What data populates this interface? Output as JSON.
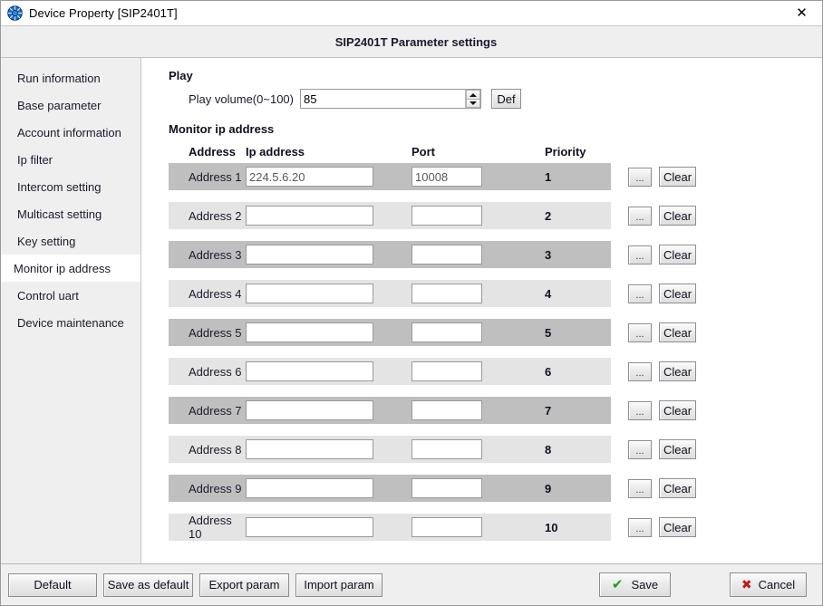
{
  "window": {
    "title": "Device Property [SIP2401T]",
    "icon": "globe-icon",
    "close_label": "✕"
  },
  "banner": {
    "title": "SIP2401T Parameter settings"
  },
  "sidebar": {
    "items": [
      {
        "label": "Run information",
        "selected": false
      },
      {
        "label": "Base parameter",
        "selected": false
      },
      {
        "label": "Account information",
        "selected": false
      },
      {
        "label": "Ip filter",
        "selected": false
      },
      {
        "label": "Intercom setting",
        "selected": false
      },
      {
        "label": "Multicast setting",
        "selected": false
      },
      {
        "label": "Key setting",
        "selected": false
      },
      {
        "label": "Monitor ip address",
        "selected": true
      },
      {
        "label": "Control uart",
        "selected": false
      },
      {
        "label": "Device maintenance",
        "selected": false
      }
    ]
  },
  "play": {
    "group_title": "Play",
    "volume_label": "Play volume(0~100)",
    "volume_value": "85",
    "def_button": "Def",
    "spinner_up_icon": "chevron-up-icon",
    "spinner_down_icon": "chevron-down-icon"
  },
  "monitor": {
    "group_title": "Monitor ip address",
    "headers": {
      "address": "Address",
      "ip": "Ip address",
      "port": "Port",
      "priority": "Priority"
    },
    "browse_button": "...",
    "clear_button": "Clear",
    "rows": [
      {
        "address": "Address 1",
        "ip": "224.5.6.20",
        "port": "10008",
        "priority": "1"
      },
      {
        "address": "Address 2",
        "ip": "",
        "port": "",
        "priority": "2"
      },
      {
        "address": "Address 3",
        "ip": "",
        "port": "",
        "priority": "3"
      },
      {
        "address": "Address 4",
        "ip": "",
        "port": "",
        "priority": "4"
      },
      {
        "address": "Address 5",
        "ip": "",
        "port": "",
        "priority": "5"
      },
      {
        "address": "Address 6",
        "ip": "",
        "port": "",
        "priority": "6"
      },
      {
        "address": "Address 7",
        "ip": "",
        "port": "",
        "priority": "7"
      },
      {
        "address": "Address 8",
        "ip": "",
        "port": "",
        "priority": "8"
      },
      {
        "address": "Address 9",
        "ip": "",
        "port": "",
        "priority": "9"
      },
      {
        "address": "Address 10",
        "ip": "",
        "port": "",
        "priority": "10"
      }
    ]
  },
  "footer": {
    "default_button": "Default",
    "save_as_default_button": "Save as default",
    "export_param_button": "Export param",
    "import_param_button": "Import param",
    "save_button": "Save",
    "save_icon": "check-icon",
    "cancel_button": "Cancel",
    "cancel_icon": "cross-icon"
  },
  "colors": {
    "row_odd": "#bfbfbf",
    "row_even": "#e4e4e4",
    "panel": "#efefef",
    "save_check": "#1a9e1a",
    "cancel_x": "#c01818"
  }
}
